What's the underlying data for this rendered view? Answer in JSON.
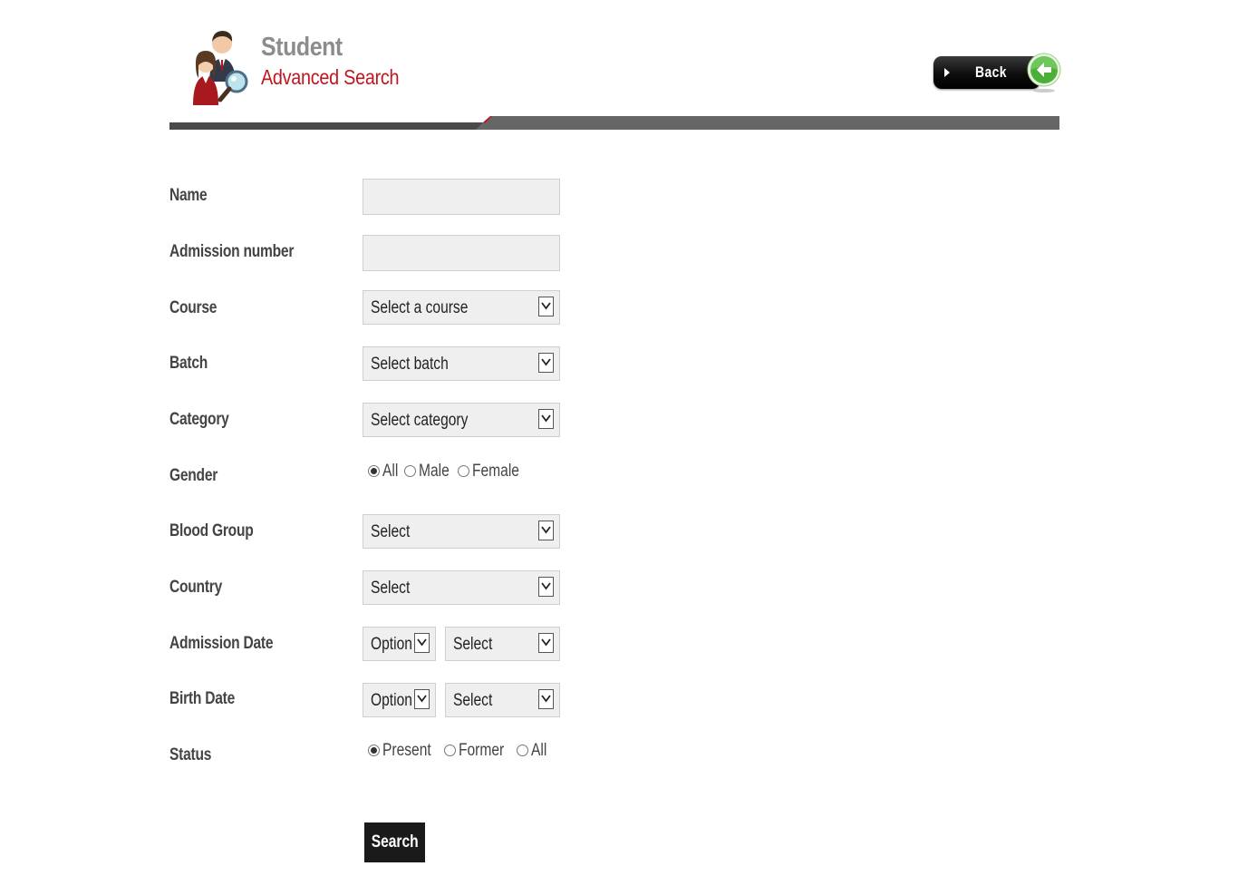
{
  "header": {
    "title": "Student",
    "subtitle": "Advanced Search",
    "back_label": "Back",
    "accent_color": "#c2161e",
    "icon": "students-search-icon"
  },
  "form": {
    "name": {
      "label": "Name",
      "value": ""
    },
    "admission_number": {
      "label": "Admission number",
      "value": ""
    },
    "course": {
      "label": "Course",
      "selected": "Select a course"
    },
    "batch": {
      "label": "Batch",
      "selected": "Select batch"
    },
    "category": {
      "label": "Category",
      "selected": "Select category"
    },
    "gender": {
      "label": "Gender",
      "options": [
        "All",
        "Male",
        "Female"
      ],
      "checked": "All"
    },
    "blood_group": {
      "label": "Blood Group",
      "selected": "Select"
    },
    "country": {
      "label": "Country",
      "selected": "Select"
    },
    "admission_date": {
      "label": "Admission Date",
      "option": "Option",
      "selected": "Select"
    },
    "birth_date": {
      "label": "Birth Date",
      "option": "Option",
      "selected": "Select"
    },
    "status": {
      "label": "Status",
      "options": [
        "Present",
        "Former",
        "All"
      ],
      "checked": "Present"
    },
    "search_label": "Search"
  }
}
